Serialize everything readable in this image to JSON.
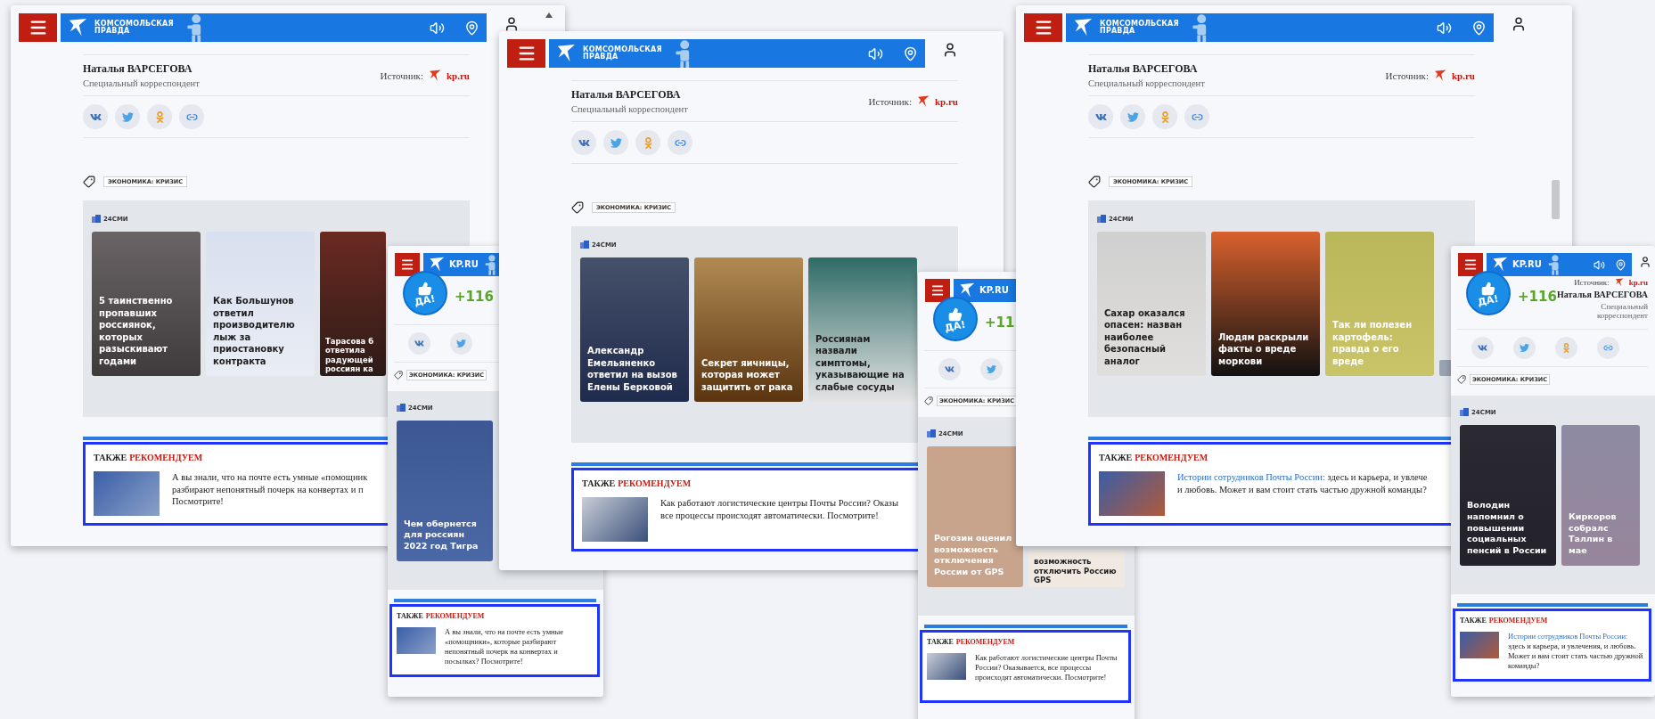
{
  "windows": [
    {
      "kind": "desktop",
      "logo": "КОМСОМОЛЬСКАЯ ПРАВДА",
      "tools": true,
      "author": {
        "name": "Наталья ВАРСЕГОВА",
        "role": "Специальный корреспондент"
      },
      "source": {
        "label": "Источник:",
        "site": "kp.ru"
      },
      "share": [
        {
          "kind": "vk"
        },
        {
          "kind": "twitter"
        },
        {
          "kind": "ok"
        },
        {
          "kind": "link"
        }
      ],
      "tag": "ЭКОНОМИКА: КРИЗИС",
      "feed": {
        "label": "24СМИ",
        "more": true,
        "cards": [
          {
            "title": "5 таинственно пропавших россиянок, которых разыскивают годами",
            "dark_text": false
          },
          {
            "title": "Как Большунов ответил производителю лыж за приостановку контракта",
            "dark_text": true
          },
          {
            "title": "Тарасова б\nответила\nрадующей\nроссиян ка",
            "dark_text": false
          }
        ]
      },
      "recommend": {
        "lead": "ТАКЖЕ",
        "accent": "РЕКОМЕНДУЕМ",
        "text": "А вы знали, что на почте есть умные «помощник\nразбирают непонятный почерк на конвертах и п\nПосмотрите!"
      }
    },
    {
      "kind": "desktop",
      "logo": "КОМСОМОЛЬСКАЯ ПРАВДА",
      "tools": true,
      "author": {
        "name": "Наталья ВАРСЕГОВА",
        "role": "Специальный корреспондент"
      },
      "source": {
        "label": "Источник:",
        "site": "kp.ru"
      },
      "share": [
        {
          "kind": "vk"
        },
        {
          "kind": "twitter"
        },
        {
          "kind": "ok"
        },
        {
          "kind": "link"
        }
      ],
      "tag": "ЭКОНОМИКА: КРИЗИС",
      "feed": {
        "label": "24СМИ",
        "more": true,
        "cards": [
          {
            "title": "Александр Емельяненко ответил на вызов Елены Берковой",
            "dark_text": false
          },
          {
            "title": "Секрет яичницы, которая может защитить от рака",
            "dark_text": false
          },
          {
            "title": "Россиянам назвали симптомы, указывающие на слабые сосуды",
            "dark_text": true
          }
        ]
      },
      "recommend": {
        "lead": "ТАКЖЕ",
        "accent": "РЕКОМЕНДУЕМ",
        "text": "Как работают логистические центры Почты России? Оказы\nвсе процессы происходят автоматически. Посмотрите!"
      }
    },
    {
      "kind": "desktop",
      "logo": "КОМСОМОЛЬСКАЯ ПРАВДА",
      "tools": true,
      "author": {
        "name": "Наталья ВАРСЕГОВА",
        "role": "Специальный корреспондент"
      },
      "source": {
        "label": "Источник:",
        "site": "kp.ru"
      },
      "share": [
        {
          "kind": "vk"
        },
        {
          "kind": "twitter"
        },
        {
          "kind": "ok"
        },
        {
          "kind": "link"
        }
      ],
      "tag": "ЭКОНОМИКА: КРИЗИС",
      "feed": {
        "label": "24СМИ",
        "more": true,
        "cards": [
          {
            "title": "Сахар оказался опасен: назван наиболее безопасный аналог",
            "dark_text": true
          },
          {
            "title": "Людям раскрыли факты о вреде моркови",
            "dark_text": false
          },
          {
            "title": "Так ли полезен картофель: правда о его вреде",
            "dark_text": false
          }
        ]
      },
      "recommend": {
        "lead": "ТАКЖЕ",
        "accent": "РЕКОМЕНДУЕМ",
        "link": "Истории сотрудников Почты России:",
        "text": "здесь и карьера, и увлече\nи любовь. Может и вам стоит стать частью дружной команды?"
      }
    },
    {
      "kind": "mobile",
      "logo": "KP.RU",
      "tools": false,
      "rating": {
        "badge": "ДА!",
        "count": "+116"
      },
      "share": [
        {
          "kind": "vk"
        },
        {
          "kind": "twitter"
        }
      ],
      "tag": "ЭКОНОМИКА: КРИЗИС",
      "feed": {
        "label": "24СМИ",
        "more": false,
        "cards": [
          {
            "title": "Чем обернется для россиян 2022 год Тигра",
            "dark_text": false
          }
        ]
      },
      "recommend": {
        "lead": "ТАКЖЕ",
        "accent": "РЕКОМЕНДУЕМ",
        "text": "А вы знали, что на почте есть умные «помощники», которые разбирают непонятный почерк на конвертах и посылках? Посмотрите!"
      }
    },
    {
      "kind": "mobile",
      "logo": "KP.RU",
      "tools": false,
      "rating": {
        "badge": "ДА!",
        "count": "+11"
      },
      "share": [
        {
          "kind": "vk"
        },
        {
          "kind": "twitter"
        }
      ],
      "tag": "ЭКОНОМИКА: КРИЗИС",
      "feed": {
        "label": "24СМИ",
        "more": false,
        "cards": [
          {
            "title": "Рогозин оценил возможность отключения России от GPS",
            "dark_text": false
          },
          {
            "title": "возможность\nотключить Россию\nGPS",
            "dark_text": true
          }
        ]
      },
      "recommend": {
        "lead": "ТАКЖЕ",
        "accent": "РЕКОМЕНДУЕМ",
        "text": "Как работают логистические центры Почты России? Оказывается, все процессы происходят автоматически. Посмотрите!"
      }
    },
    {
      "kind": "mobile",
      "logo": "KP.RU",
      "tools": true,
      "rating": {
        "badge": "ДА!",
        "count": "+116"
      },
      "author": {
        "name": "Наталья ВАРСЕГОВА",
        "role": "Специальный корреспондент"
      },
      "source": {
        "label": "Источник:",
        "site": "kp.ru"
      },
      "share": [
        {
          "kind": "vk"
        },
        {
          "kind": "twitter"
        },
        {
          "kind": "ok"
        },
        {
          "kind": "link"
        }
      ],
      "tag": "ЭКОНОМИКА: КРИЗИС",
      "feed": {
        "label": "24СМИ",
        "more": false,
        "cards": [
          {
            "title": "Володин напомнил о повышении социальных пенсий в России",
            "dark_text": false
          },
          {
            "title": "Киркоров собралс\nТаллин в мае",
            "dark_text": false
          }
        ]
      },
      "recommend": {
        "lead": "ТАКЖЕ",
        "accent": "РЕКОМЕНДУЕМ",
        "link": "Истории сотрудников Почты России:",
        "text": "здесь и карьера, и увлечения, и любовь. Может и вам стоит стать частью дружной команды?"
      }
    }
  ]
}
